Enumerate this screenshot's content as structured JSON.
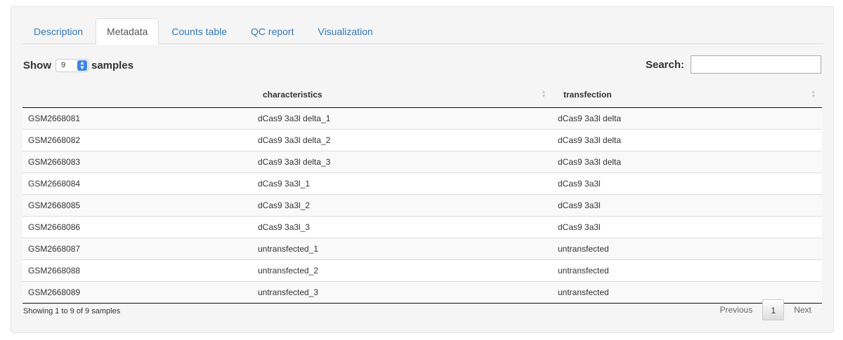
{
  "tabs": [
    {
      "label": "Description",
      "active": false
    },
    {
      "label": "Metadata",
      "active": true
    },
    {
      "label": "Counts table",
      "active": false
    },
    {
      "label": "QC report",
      "active": false
    },
    {
      "label": "Visualization",
      "active": false
    }
  ],
  "length": {
    "prefix": "Show",
    "value": "9",
    "suffix": "samples"
  },
  "search": {
    "label": "Search:",
    "value": ""
  },
  "table": {
    "columns": [
      "",
      "characteristics",
      "transfection"
    ],
    "rows": [
      [
        "GSM2668081",
        "dCas9 3a3l delta_1",
        "dCas9 3a3l delta"
      ],
      [
        "GSM2668082",
        "dCas9 3a3l delta_2",
        "dCas9 3a3l delta"
      ],
      [
        "GSM2668083",
        "dCas9 3a3l delta_3",
        "dCas9 3a3l delta"
      ],
      [
        "GSM2668084",
        "dCas9 3a3l_1",
        "dCas9 3a3l"
      ],
      [
        "GSM2668085",
        "dCas9 3a3l_2",
        "dCas9 3a3l"
      ],
      [
        "GSM2668086",
        "dCas9 3a3l_3",
        "dCas9 3a3l"
      ],
      [
        "GSM2668087",
        "untransfected_1",
        "untransfected"
      ],
      [
        "GSM2668088",
        "untransfected_2",
        "untransfected"
      ],
      [
        "GSM2668089",
        "untransfected_3",
        "untransfected"
      ]
    ]
  },
  "info": "Showing 1 to 9 of 9 samples",
  "pager": {
    "previous": "Previous",
    "current": "1",
    "next": "Next"
  },
  "colors": {
    "link": "#337ab7",
    "select_accent": "#3d84e6",
    "panel_bg": "#f5f5f5"
  }
}
